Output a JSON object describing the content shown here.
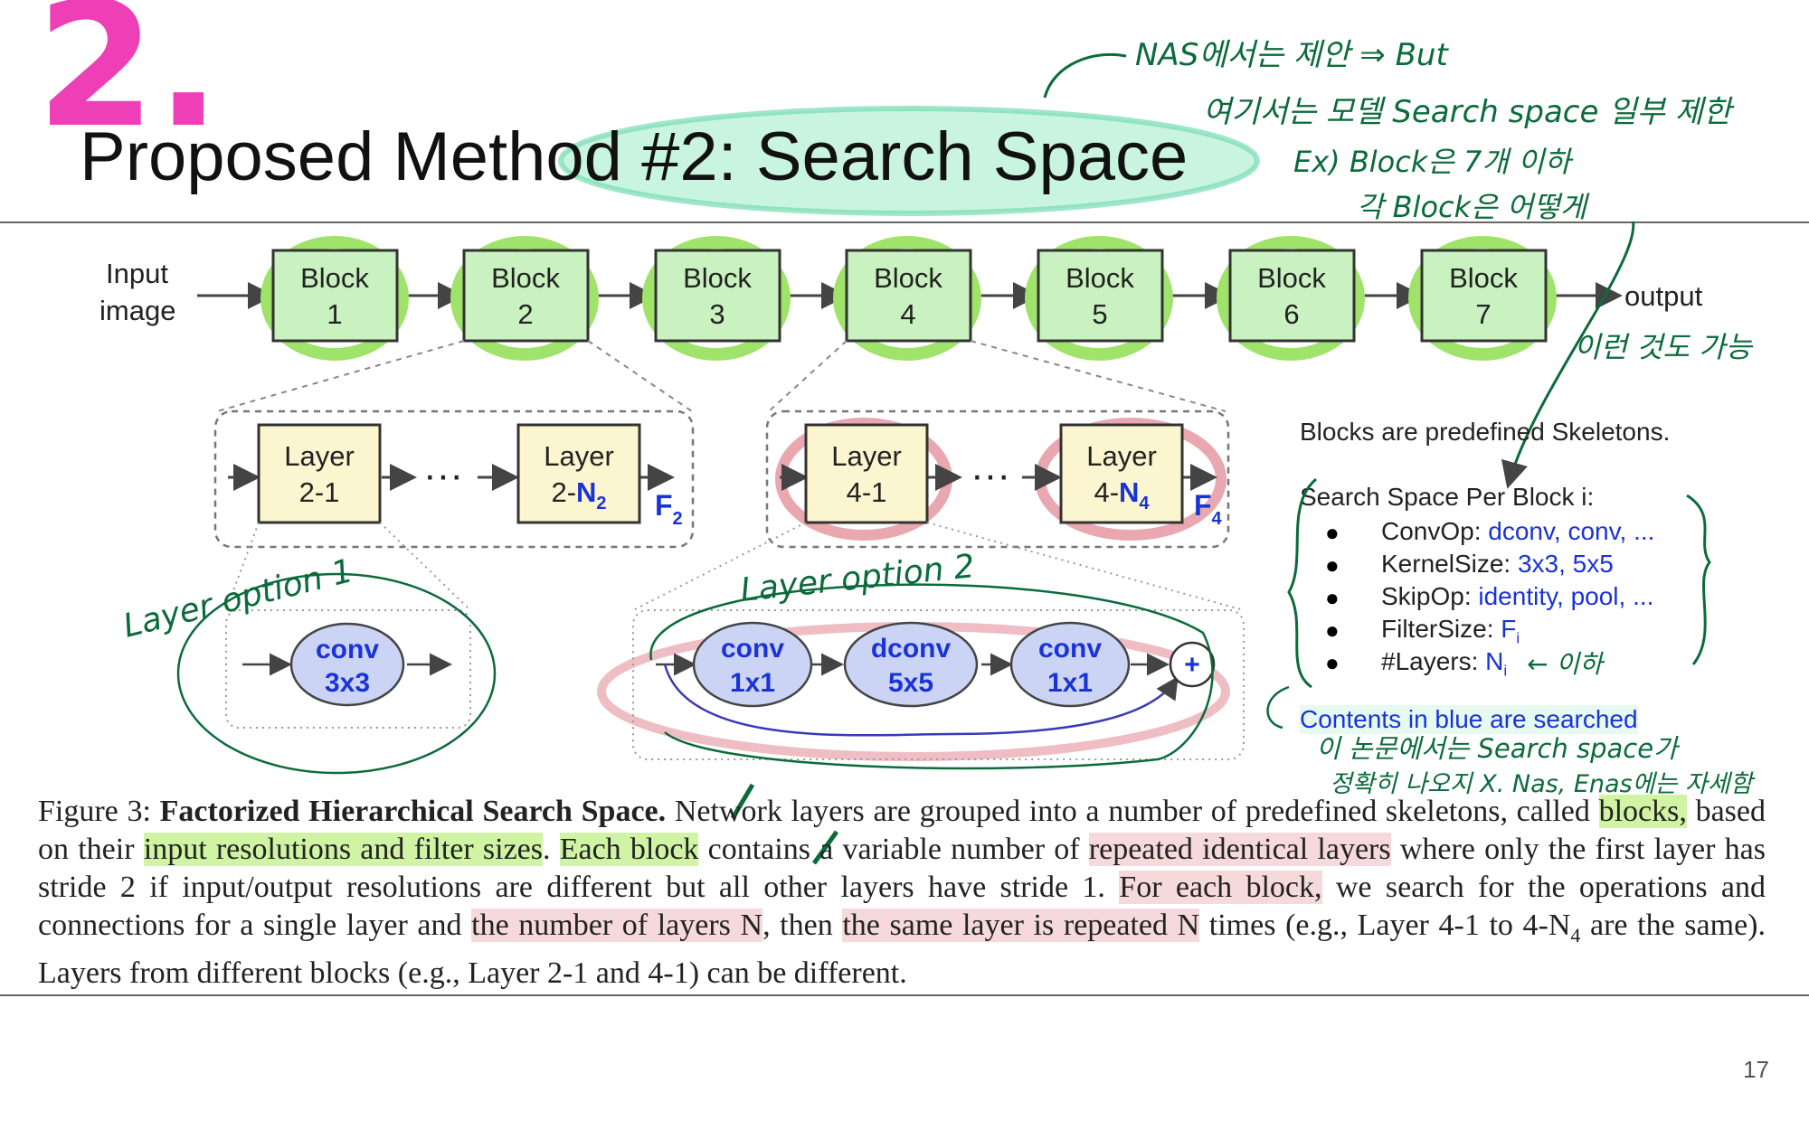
{
  "slide": {
    "title": "Proposed Method #2: Search Space",
    "page_number": "17"
  },
  "diagram": {
    "input_label": [
      "Input",
      "image"
    ],
    "output_label": "output",
    "blocks": [
      {
        "label": "Block",
        "num": "1"
      },
      {
        "label": "Block",
        "num": "2"
      },
      {
        "label": "Block",
        "num": "3"
      },
      {
        "label": "Block",
        "num": "4"
      },
      {
        "label": "Block",
        "num": "5"
      },
      {
        "label": "Block",
        "num": "6"
      },
      {
        "label": "Block",
        "num": "7"
      }
    ],
    "group_left": {
      "layer_a": {
        "label": "Layer",
        "id": "2-1"
      },
      "layer_b": {
        "label": "Layer",
        "prefix": "2-",
        "n": "N",
        "sub": "2"
      },
      "f": "F",
      "f_sub": "2"
    },
    "group_right": {
      "layer_a": {
        "label": "Layer",
        "id": "4-1"
      },
      "layer_b": {
        "label": "Layer",
        "prefix": "4-",
        "n": "N",
        "sub": "4"
      },
      "f": "F",
      "f_sub": "4"
    },
    "ellipsis": "···",
    "option1_ops": [
      {
        "a": "conv",
        "b": "3x3"
      }
    ],
    "option2_ops": [
      {
        "a": "conv",
        "b": "1x1"
      },
      {
        "a": "dconv",
        "b": "5x5"
      },
      {
        "a": "conv",
        "b": "1x1"
      }
    ],
    "plus": "+"
  },
  "side_panel": {
    "skeleton_note": "Blocks are predefined Skeletons.",
    "search_header": "Search Space Per Block i:",
    "items": [
      {
        "key": "ConvOp: ",
        "value": "dconv, conv, ..."
      },
      {
        "key": "KernelSize: ",
        "value": "3x3, 5x5"
      },
      {
        "key": "SkipOp: ",
        "value": "identity, pool, ..."
      },
      {
        "key": "FilterSize: ",
        "value": "F",
        "sub": "i"
      },
      {
        "key": "#Layers: ",
        "value": "N",
        "sub": "i"
      }
    ],
    "searched_note": "Contents in blue are searched"
  },
  "caption": {
    "label": "Figure 3: ",
    "bold": "Factorized Hierarchical Search Space.",
    "t1": " Network layers are grouped into a number of predefined skeletons, called ",
    "h1": "blocks,",
    "t2": " based on their ",
    "h2": "input resolutions and filter sizes",
    "t3": ". ",
    "h3": "Each block",
    "t4": " contains a variable number of ",
    "p1": "repeated identical layers",
    "t5": " where only the first layer has stride 2 if input/output resolutions are different but all other layers have stride 1. ",
    "p2": "For each block,",
    "t6": " we search for the operations and connections for a single layer and ",
    "p3": "the number of layers N",
    "t7": ", then ",
    "p4": "the same layer is repeated N",
    "t8": " times (e.g., Layer 4-1 to 4-N",
    "t8sub": "4",
    "t9": " are the same). Layers from different blocks (e.g., Layer 2-1 and 4-1) can be different."
  },
  "annotations": {
    "big_number": "2.",
    "note_line1": "NAS에서는 제안 ⇒ But",
    "note_line2": "여기서는 모델 Search space 일부 제한",
    "note_line3": "Ex) Block은 7개 이하",
    "note_line4": "각 Block은 어떻게",
    "note_line5": "이런 것도 가능",
    "layer_option1": "Layer option 1",
    "layer_option2": "Layer option 2",
    "arrow_note": "← 이하",
    "bottom_note1": "이 논문에서는 Search space가",
    "bottom_note2": "정확히 나오지 X. Nas, Enas에는 자세함"
  },
  "colors": {
    "block_fill": "#c9f2c0",
    "layer_fill": "#fbf6cf",
    "op_fill": "#cbd4f5",
    "marker_green": "#9fe36b",
    "marker_pink": "#e9a7b0",
    "marker_mint": "#b6f0d6",
    "magenta": "#ee3fb6",
    "pen_green": "#0b6b3a",
    "searched_blue": "#1a33d6"
  }
}
